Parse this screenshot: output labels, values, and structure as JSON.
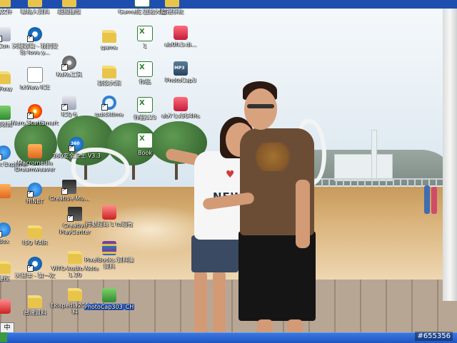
{
  "watermark": "#655356",
  "taskbar": {},
  "colors": {
    "taskbar": "#1f55c2",
    "selection": "#2d5fc8",
    "label_text": "#ffffff"
  },
  "shirt_print": {
    "her": "NEW"
  },
  "pin_box": {
    "label": "中"
  },
  "icons": [
    {
      "id": "c1-top",
      "label": "的文件",
      "glyph": "folder"
    },
    {
      "id": "c1-1",
      "label": "Con",
      "glyph": "shortcut"
    },
    {
      "id": "c1-2",
      "label": "- Foxy",
      "glyph": "folder"
    },
    {
      "id": "c1-3",
      "label": "回收筒",
      "glyph": "green"
    },
    {
      "id": "c1-4",
      "label": "Internet Explorer",
      "glyph": "ie"
    },
    {
      "id": "c1-5",
      "label": "",
      "glyph": "orange"
    },
    {
      "id": "c1-6",
      "label": "Box",
      "glyph": "ie"
    },
    {
      "id": "c1-7",
      "label": "捷徑",
      "glyph": "folder"
    },
    {
      "id": "c1-8",
      "label": "",
      "glyph": "red"
    },
    {
      "id": "c2-top",
      "label": "聯絡人資料",
      "glyph": "folder"
    },
    {
      "id": "c2-1",
      "label": "天韻歌聲 - 我們愛你 love y...",
      "glyph": "media"
    },
    {
      "id": "c2-2",
      "label": "IxView ICE",
      "glyph": "sheet"
    },
    {
      "id": "c2-3",
      "label": "Nero StartSmart",
      "glyph": "disc"
    },
    {
      "id": "c2-4",
      "label": "Macromedia Dreamweaver",
      "glyph": "orange"
    },
    {
      "id": "c2-5",
      "label": "HINET",
      "glyph": "ie"
    },
    {
      "id": "c2-6",
      "label": "ISO_FAIR",
      "glyph": "folder"
    },
    {
      "id": "c2-7",
      "label": "天音樂 - 第一次",
      "glyph": "media"
    },
    {
      "id": "c2-8",
      "label": "台灣資料",
      "glyph": "folder"
    },
    {
      "id": "c3-top",
      "label": "超級捷徑",
      "glyph": "folder"
    },
    {
      "id": "c3-1",
      "label": "KuKu工具",
      "glyph": "gear"
    },
    {
      "id": "c3-2",
      "label": "ICQ 6",
      "glyph": "shortcut"
    },
    {
      "id": "c3-3",
      "label": "360安全卫士 V3.3",
      "glyph": "360"
    },
    {
      "id": "c3-4",
      "label": "Creative Mu...",
      "glyph": "pc"
    },
    {
      "id": "c3-5",
      "label": "Creative PlayCenter",
      "glyph": "pc"
    },
    {
      "id": "c3-6",
      "label": "VITO Audio Note 1.10",
      "glyph": "folder"
    },
    {
      "id": "c3-7",
      "label": "Ekispedia2010 資料",
      "glyph": "folder"
    },
    {
      "id": "c4-1",
      "label": "game",
      "glyph": "folder"
    },
    {
      "id": "c4-2",
      "label": "訪談大綱",
      "glyph": "folder"
    },
    {
      "id": "c4-3",
      "label": "quicktime",
      "glyph": "q"
    },
    {
      "id": "c4-4",
      "label": "行動超商 1 to超省",
      "glyph": "red"
    },
    {
      "id": "c4-5",
      "label": "PixelBooks 資料庫資料",
      "glyph": "books"
    },
    {
      "id": "c4-6",
      "label": "PhotoCap303_CH_B035",
      "glyph": "green",
      "selected": true
    },
    {
      "id": "c5-top",
      "label": "Game成 遊戲大廳",
      "glyph": "excel"
    },
    {
      "id": "c5-1",
      "label": "1",
      "glyph": "excel"
    },
    {
      "id": "c5-2",
      "label": "作品",
      "glyph": "excel"
    },
    {
      "id": "c5-3",
      "label": "作品123",
      "glyph": "excel"
    },
    {
      "id": "c5-4",
      "label": "Book",
      "glyph": "excel"
    },
    {
      "id": "c6-top",
      "label": "監視系統",
      "glyph": "folder"
    },
    {
      "id": "c6-1",
      "label": "ab0fk3.di...",
      "glyph": "app"
    },
    {
      "id": "c6-2",
      "label": "PhotoCap3",
      "glyph": "mp3"
    },
    {
      "id": "c6-3",
      "label": "ab7 Lv5G4Hs",
      "glyph": "app"
    }
  ]
}
